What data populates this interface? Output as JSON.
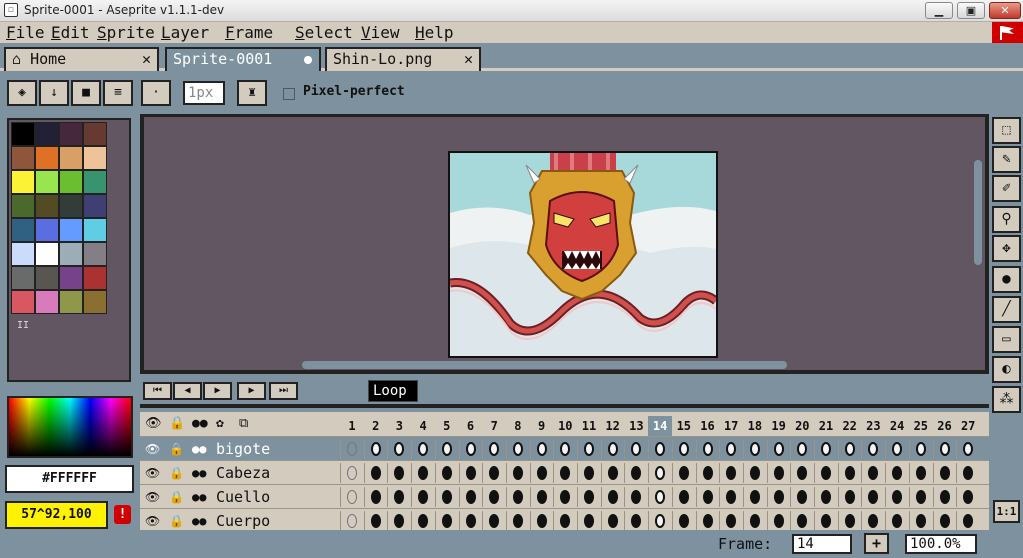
{
  "window": {
    "title": "Sprite-0001 - Aseprite v1.1.1-dev",
    "icon": "aseprite-app-icon",
    "controls": {
      "minimize": "▁",
      "maximize": "▣",
      "close": "✕"
    }
  },
  "menu": [
    "File",
    "Edit",
    "Sprite",
    "Layer",
    "Frame",
    "Select",
    "View",
    "Help"
  ],
  "tabs": [
    {
      "label": "Home",
      "icon": "home-icon",
      "close": "✕"
    },
    {
      "label": "Sprite-0001",
      "active": true,
      "modified": true
    },
    {
      "label": "Shin-Lo.png",
      "close": "✕"
    }
  ],
  "toolbar": {
    "buttons": [
      {
        "name": "eraser-mode-icon",
        "glyph": "◈"
      },
      {
        "name": "arrow-down-icon",
        "glyph": "↓"
      },
      {
        "name": "folder-icon",
        "glyph": "■"
      },
      {
        "name": "menu-lines-icon",
        "glyph": "≡"
      }
    ],
    "brush_shape": "·",
    "brush_size": "1px",
    "ink_icon": "ink-bucket-icon",
    "pixel_perfect_label": "Pixel-perfect",
    "pixel_perfect_checked": false
  },
  "palette": {
    "colors": [
      "#000000",
      "#222034",
      "#45283c",
      "#663931",
      "#8f563b",
      "#df7126",
      "#d9a066",
      "#eec39a",
      "#fbf236",
      "#99e550",
      "#6abe30",
      "#37946e",
      "#4b692f",
      "#524b24",
      "#323c39",
      "#3f3f74",
      "#306082",
      "#5b6ee1",
      "#639bff",
      "#5fcde4",
      "#cbdbfc",
      "#ffffff",
      "#9badb7",
      "#847e87",
      "#696a6a",
      "#595652",
      "#76428a",
      "#ac3232",
      "#d95763",
      "#d77bba",
      "#8f974a",
      "#8a6f30"
    ],
    "toggle_label": "II"
  },
  "color": {
    "hex": "#FFFFFF",
    "position": "57^92,100",
    "warning": "!"
  },
  "tools": [
    {
      "name": "marquee-tool-icon",
      "glyph": "⬚"
    },
    {
      "name": "pencil-tool-icon",
      "glyph": "✎"
    },
    {
      "name": "eyedropper-tool-icon",
      "glyph": "✐"
    },
    {
      "name": "zoom-tool-icon",
      "glyph": "⚲"
    },
    {
      "name": "move-tool-icon",
      "glyph": "✥"
    },
    {
      "name": "fill-tool-icon",
      "glyph": "●"
    },
    {
      "name": "line-tool-icon",
      "glyph": "╱"
    },
    {
      "name": "rectangle-tool-icon",
      "glyph": "▭"
    },
    {
      "name": "blur-tool-icon",
      "glyph": "◐"
    },
    {
      "name": "spray-tool-icon",
      "glyph": "⁂"
    }
  ],
  "pixel_ratio": "1:1",
  "playback": [
    {
      "name": "first-frame-button",
      "glyph": "⏮"
    },
    {
      "name": "prev-frame-button",
      "glyph": "◀"
    },
    {
      "name": "play-button",
      "glyph": "▶"
    },
    {
      "name": "next-frame-button",
      "glyph": "▶"
    },
    {
      "name": "last-frame-button",
      "glyph": "⏭"
    }
  ],
  "timeline": {
    "tag": "Loop",
    "header_icons": [
      "eye-icon",
      "lock-icon",
      "link-icon",
      "gear-icon",
      "onion-skin-icon"
    ],
    "header_glyphs": [
      "👁",
      "🔒",
      "●●",
      "✿",
      "⧉"
    ],
    "frames": [
      "1",
      "2",
      "3",
      "4",
      "5",
      "6",
      "7",
      "8",
      "9",
      "10",
      "11",
      "12",
      "13",
      "14",
      "15",
      "16",
      "17",
      "18",
      "19",
      "20",
      "21",
      "22",
      "23",
      "24",
      "25",
      "26",
      "27"
    ],
    "current_frame": "14",
    "layers": [
      {
        "name": "bigote",
        "selected": true,
        "keys": "empty"
      },
      {
        "name": "Cabeza",
        "keys": "filled"
      },
      {
        "name": "Cuello",
        "keys": "filled"
      },
      {
        "name": "Cuerpo",
        "keys": "filled"
      }
    ]
  },
  "status": {
    "frame_label": "Frame:",
    "frame_value": "14",
    "add": "+",
    "zoom": "100.0%"
  }
}
